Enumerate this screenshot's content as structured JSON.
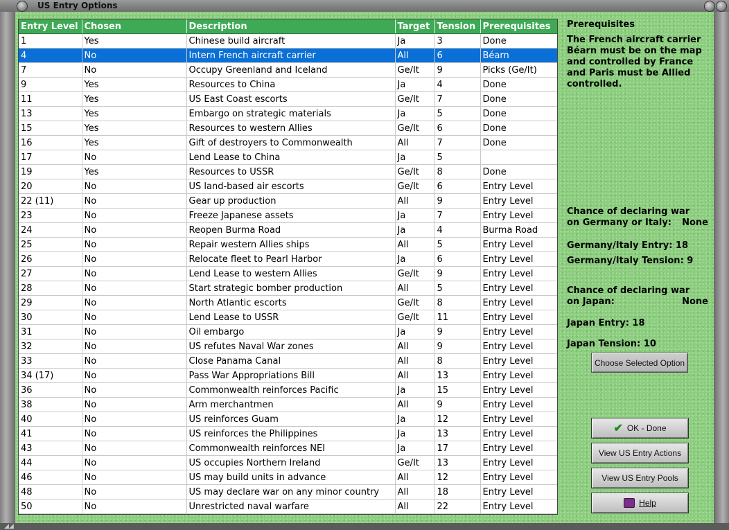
{
  "window": {
    "title": "US Entry Options"
  },
  "table": {
    "headers": [
      "Entry Level",
      "Chosen",
      "Description",
      "Target",
      "Tension",
      "Prerequisites"
    ],
    "selected_index": 1,
    "rows": [
      [
        "1",
        "Yes",
        "Chinese build aircraft",
        "Ja",
        "3",
        "Done"
      ],
      [
        "4",
        "No",
        "Intern French aircraft carrier",
        "All",
        "6",
        "Béarn"
      ],
      [
        "7",
        "No",
        "Occupy Greenland and Iceland",
        "Ge/It",
        "9",
        "Picks (Ge/It)"
      ],
      [
        "9",
        "Yes",
        "Resources to China",
        "Ja",
        "4",
        "Done"
      ],
      [
        "11",
        "Yes",
        "US East Coast escorts",
        "Ge/It",
        "7",
        "Done"
      ],
      [
        "13",
        "Yes",
        "Embargo on strategic materials",
        "Ja",
        "5",
        "Done"
      ],
      [
        "15",
        "Yes",
        "Resources to western Allies",
        "Ge/It",
        "6",
        "Done"
      ],
      [
        "16",
        "Yes",
        "Gift of destroyers to Commonwealth",
        "All",
        "7",
        "Done"
      ],
      [
        "17",
        "No",
        "Lend Lease to China",
        "Ja",
        "5",
        ""
      ],
      [
        "19",
        "Yes",
        "Resources to USSR",
        "Ge/It",
        "8",
        "Done"
      ],
      [
        "20",
        "No",
        "US land-based air escorts",
        "Ge/It",
        "6",
        "Entry Level"
      ],
      [
        "22 (11)",
        "No",
        "Gear up production",
        "All",
        "9",
        "Entry Level"
      ],
      [
        "23",
        "No",
        "Freeze Japanese assets",
        "Ja",
        "7",
        "Entry Level"
      ],
      [
        "24",
        "No",
        "Reopen Burma Road",
        "Ja",
        "4",
        "Burma Road"
      ],
      [
        "25",
        "No",
        "Repair western Allies ships",
        "All",
        "5",
        "Entry Level"
      ],
      [
        "26",
        "No",
        "Relocate fleet to Pearl Harbor",
        "Ja",
        "6",
        "Entry Level"
      ],
      [
        "27",
        "No",
        "Lend Lease to western Allies",
        "Ge/It",
        "9",
        "Entry Level"
      ],
      [
        "28",
        "No",
        "Start strategic bomber production",
        "All",
        "5",
        "Entry Level"
      ],
      [
        "29",
        "No",
        "North Atlantic escorts",
        "Ge/It",
        "8",
        "Entry Level"
      ],
      [
        "30",
        "No",
        "Lend Lease to USSR",
        "Ge/It",
        "11",
        "Entry Level"
      ],
      [
        "31",
        "No",
        "Oil embargo",
        "Ja",
        "9",
        "Entry Level"
      ],
      [
        "32",
        "No",
        "US refutes Naval War zones",
        "All",
        "9",
        "Entry Level"
      ],
      [
        "33",
        "No",
        "Close Panama Canal",
        "All",
        "8",
        "Entry Level"
      ],
      [
        "34 (17)",
        "No",
        "Pass War Appropriations Bill",
        "All",
        "13",
        "Entry Level"
      ],
      [
        "36",
        "No",
        "Commonwealth reinforces Pacific",
        "Ja",
        "15",
        "Entry Level"
      ],
      [
        "38",
        "No",
        "Arm merchantmen",
        "All",
        "9",
        "Entry Level"
      ],
      [
        "40",
        "No",
        "US reinforces Guam",
        "Ja",
        "12",
        "Entry Level"
      ],
      [
        "41",
        "No",
        "US reinforces the Philippines",
        "Ja",
        "13",
        "Entry Level"
      ],
      [
        "43",
        "No",
        "Commonwealth reinforces NEI",
        "Ja",
        "17",
        "Entry Level"
      ],
      [
        "44",
        "No",
        "US occupies Northern Ireland",
        "Ge/It",
        "13",
        "Entry Level"
      ],
      [
        "46",
        "No",
        "US may build units in advance",
        "All",
        "12",
        "Entry Level"
      ],
      [
        "48",
        "No",
        "US may declare war on any minor country",
        "All",
        "18",
        "Entry Level"
      ],
      [
        "50",
        "No",
        "Unrestricted naval warfare",
        "All",
        "22",
        "Entry Level"
      ]
    ]
  },
  "side": {
    "prereq_title": "Prerequisites",
    "prereq_text": "The French aircraft carrier Béarn must be on the map and controlled by France and Paris must be Allied controlled.",
    "chance_ger_label1": "Chance of declaring war",
    "chance_ger_label2": "on Germany or Italy:",
    "chance_ger_value": "None",
    "ger_entry": "Germany/Italy Entry: 18",
    "ger_tension": "Germany/Italy Tension: 9",
    "chance_jap_label1": "Chance of declaring war",
    "chance_jap_label2": "on Japan:",
    "chance_jap_value": "None",
    "jap_entry": "Japan Entry: 18",
    "jap_tension": "Japan Tension: 10"
  },
  "buttons": {
    "choose": "Choose Selected Option",
    "ok": "OK - Done",
    "actions": "View US Entry Actions",
    "pools": "View US Entry Pools",
    "help": "Help"
  }
}
